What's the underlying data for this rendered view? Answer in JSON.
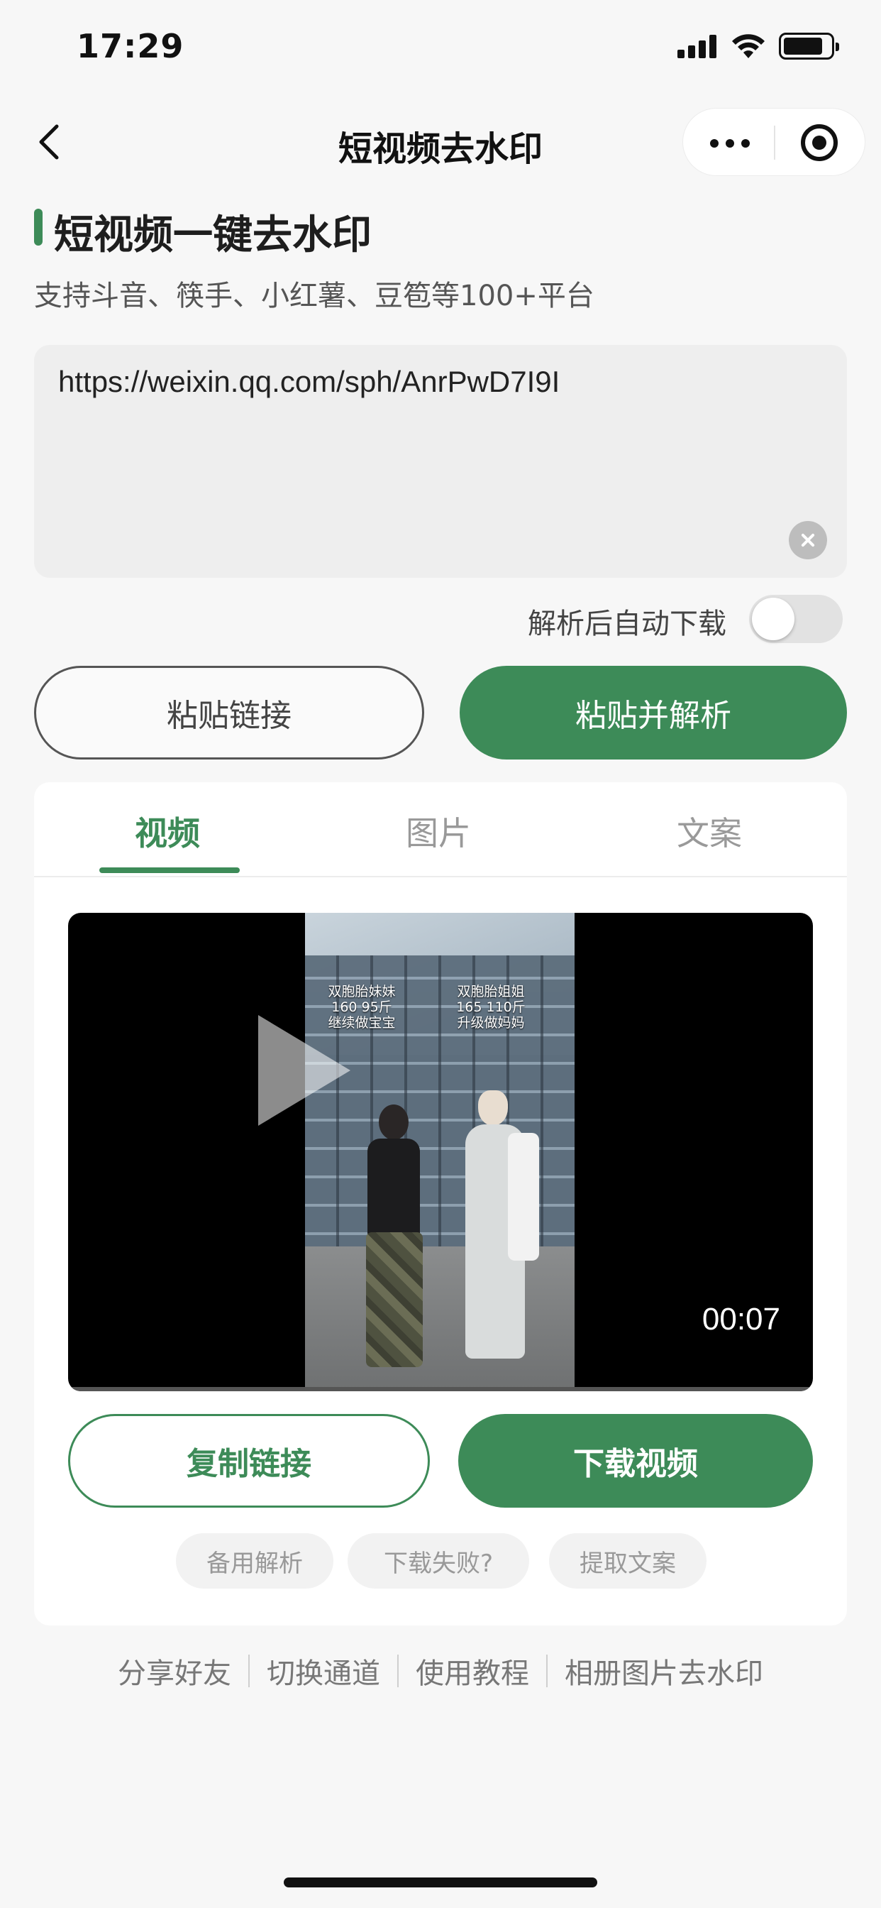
{
  "status_bar": {
    "time": "17:29"
  },
  "nav": {
    "title": "短视频去水印"
  },
  "header": {
    "title": "短视频一键去水印",
    "subtitle": "支持斗音、筷手、小红薯、豆笣等100+平台"
  },
  "link_input": {
    "value": "https://weixin.qq.com/sph/AnrPwD7I9I"
  },
  "auto_download": {
    "label": "解析后自动下载",
    "enabled": false
  },
  "actions": {
    "paste": "粘贴链接",
    "paste_parse": "粘贴并解析"
  },
  "result": {
    "tabs": [
      {
        "label": "视频",
        "active": true
      },
      {
        "label": "图片",
        "active": false
      },
      {
        "label": "文案",
        "active": false
      }
    ],
    "video": {
      "captions": [
        [
          "双胞胎妹妹",
          "160 95斤",
          "继续做宝宝"
        ],
        [
          "双胞胎姐姐",
          "165 110斤",
          "升级做妈妈"
        ]
      ],
      "duration": "00:07"
    },
    "copy_label": "复制链接",
    "download_label": "下载视频",
    "secondary": [
      "备用解析",
      "下载失败?",
      "提取文案"
    ]
  },
  "footer": {
    "links": [
      "分享好友",
      "切换通道",
      "使用教程",
      "相册图片去水印"
    ]
  },
  "colors": {
    "accent": "#3d8b58",
    "background": "#f7f7f7"
  }
}
